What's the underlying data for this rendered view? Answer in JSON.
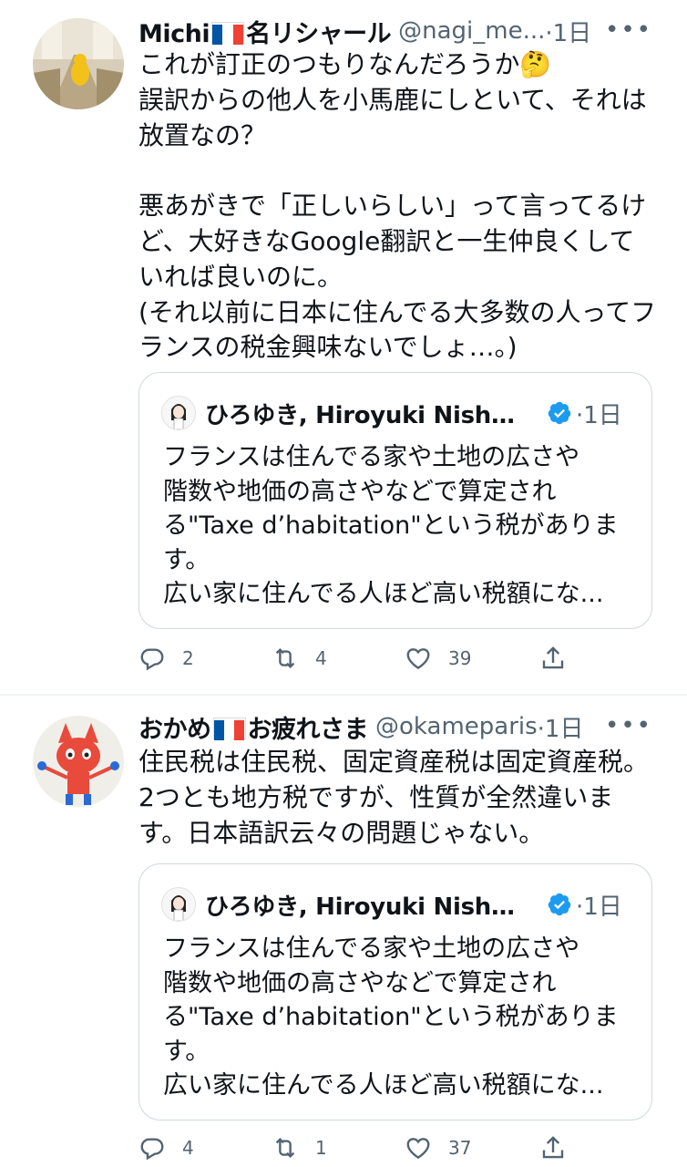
{
  "tweets": [
    {
      "name_prefix": "Michi",
      "name_suffix": "名リシャール",
      "handle": "@nagi_me...",
      "time": "·1日",
      "more": "•••",
      "text": "これが訂正のつもりなんだろうか🤔\n誤訳からの他人を小馬鹿にしといて、それは放置なの？\n\n悪あがきで「正しいらしい」って言ってるけど、大好きなGoogle翻訳と一生仲良くしていれば良いのに。\n(それ以前に日本に住んでる大多数の人ってフランスの税金興味ないでしょ…。)",
      "quote": {
        "name": "ひろゆき, Hiroyuki Nishi...",
        "time": "·1日",
        "text": "フランスは住んでる家や土地の広さや\n階数や地価の高さやなどで算定され\nる\"Taxe d’habitation\"という税がありま\nす。",
        "last_line": "広い家に住んでる人ほど高い税額にな..."
      },
      "replies": "2",
      "retweets": "4",
      "likes": "39"
    },
    {
      "name_prefix": "おかめ",
      "name_suffix": "お疲れさま",
      "handle": "@okameparis",
      "time": "·1日",
      "more": "•••",
      "text": "住民税は住民税、固定資産税は固定資産税。2つとも地方税ですが、性質が全然違います。日本語訳云々の問題じゃない。",
      "quote": {
        "name": "ひろゆき, Hiroyuki Nishi...",
        "time": "·1日",
        "text": "フランスは住んでる家や土地の広さや\n階数や地価の高さやなどで算定され\nる\"Taxe d’habitation\"という税がありま\nす。",
        "last_line": "広い家に住んでる人ほど高い税額にな..."
      },
      "replies": "4",
      "retweets": "1",
      "likes": "37"
    }
  ],
  "colors": {
    "text": "#0f1419",
    "secondary": "#536471",
    "border": "#cfd9de",
    "verified": "#1d9bf0"
  },
  "icons": {
    "reply": "reply-icon",
    "retweet": "retweet-icon",
    "like": "heart-icon",
    "share": "share-icon",
    "verified": "verified-badge-icon",
    "flag": "france-flag-icon"
  }
}
